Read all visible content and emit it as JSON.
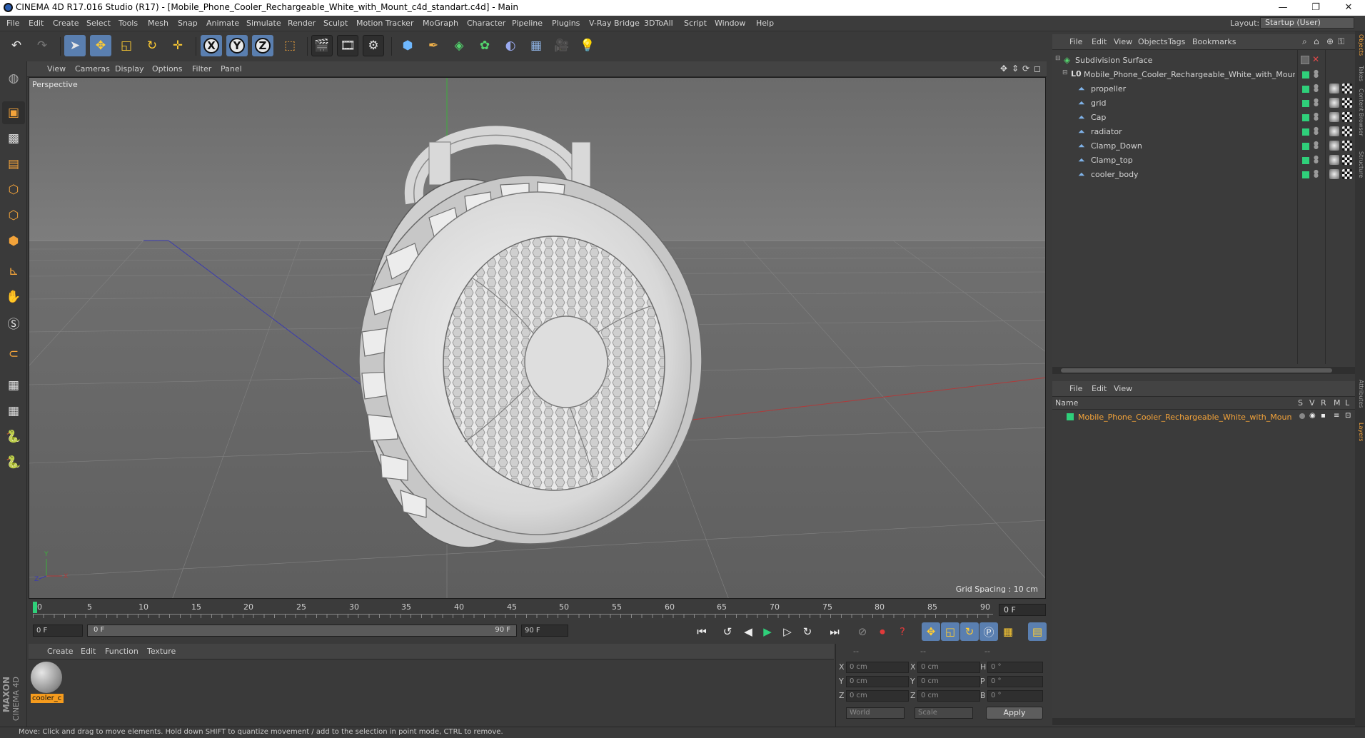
{
  "window": {
    "title": "CINEMA 4D R17.016 Studio (R17) - [Mobile_Phone_Cooler_Rechargeable_White_with_Mount_c4d_standart.c4d] - Main",
    "minimize": "—",
    "maximize": "❐",
    "close": "✕"
  },
  "menubar": {
    "items": [
      "File",
      "Edit",
      "Create",
      "Select",
      "Tools",
      "Mesh",
      "Snap",
      "Animate",
      "Simulate",
      "Render",
      "Sculpt",
      "Motion Tracker",
      "MoGraph",
      "Character",
      "Pipeline",
      "Plugins",
      "V-Ray Bridge",
      "3DToAll",
      "Script",
      "Window",
      "Help"
    ],
    "layout_label": "Layout:",
    "layout_value": "Startup (User)"
  },
  "viewport": {
    "menu": [
      "View",
      "Cameras",
      "Display",
      "Options",
      "Filter",
      "Panel"
    ],
    "camera_label": "Perspective",
    "grid_spacing": "Grid Spacing : 10 cm"
  },
  "timeline": {
    "ticks": [
      "0",
      "5",
      "10",
      "15",
      "20",
      "25",
      "30",
      "35",
      "40",
      "45",
      "50",
      "55",
      "60",
      "65",
      "70",
      "75",
      "80",
      "85",
      "90"
    ],
    "current_frame": "0 F",
    "start_field": "0 F",
    "slider_start": "0 F",
    "slider_end": "90 F",
    "end_field": "90 F"
  },
  "material_manager": {
    "menu": [
      "Create",
      "Edit",
      "Function",
      "Texture"
    ],
    "material_name": "cooler_c"
  },
  "coordinates": {
    "header_dashes": [
      "--",
      "--",
      "--"
    ],
    "rows": [
      {
        "a": "X",
        "av": "0 cm",
        "b": "X",
        "bv": "0 cm",
        "c": "H",
        "cv": "0 °"
      },
      {
        "a": "Y",
        "av": "0 cm",
        "b": "Y",
        "bv": "0 cm",
        "c": "P",
        "cv": "0 °"
      },
      {
        "a": "Z",
        "av": "0 cm",
        "b": "Z",
        "bv": "0 cm",
        "c": "B",
        "cv": "0 °"
      }
    ],
    "world": "World",
    "scale": "Scale",
    "apply": "Apply"
  },
  "object_manager": {
    "menu": [
      "File",
      "Edit",
      "View",
      "Objects",
      "Tags",
      "Bookmarks"
    ],
    "objects": [
      {
        "name": "Subdivision Surface",
        "level": 0
      },
      {
        "name": "Mobile_Phone_Cooler_Rechargeable_White_with_Mount",
        "level": 1
      },
      {
        "name": "propeller",
        "level": 2
      },
      {
        "name": "grid",
        "level": 2
      },
      {
        "name": "Cap",
        "level": 2
      },
      {
        "name": "radiator",
        "level": 2
      },
      {
        "name": "Clamp_Down",
        "level": 2
      },
      {
        "name": "Clamp_top",
        "level": 2
      },
      {
        "name": "cooler_body",
        "level": 2
      }
    ]
  },
  "layer_manager": {
    "menu": [
      "File",
      "Edit",
      "View"
    ],
    "columns": {
      "name": "Name",
      "s": "S",
      "v": "V",
      "r": "R",
      "m": "M",
      "l": "L"
    },
    "layer_name": "Mobile_Phone_Cooler_Rechargeable_White_with_Mount",
    "layer_color": "#e8a13a"
  },
  "right_tabs": [
    "Objects",
    "Takes",
    "Content Browser",
    "Structure",
    "Attributes",
    "Layers"
  ],
  "status": "Move: Click and drag to move elements. Hold down SHIFT to quantize movement / add to the selection in point mode, CTRL to remove.",
  "brand": {
    "maxon": "MAXON",
    "cinema": "CINEMA 4D"
  },
  "colors": {
    "accent": "#5a7fb0",
    "object_green": "#2fd07a",
    "layer_orange": "#e8a13a"
  }
}
